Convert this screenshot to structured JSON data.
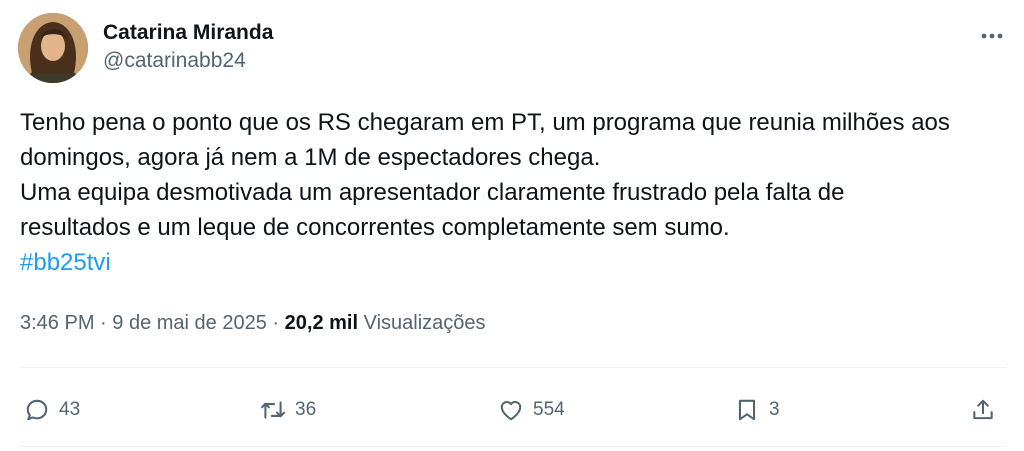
{
  "author": {
    "name": "Catarina Miranda",
    "handle": "@catarinabb24"
  },
  "tweet": {
    "lines": [
      "Tenho pena o ponto que os RS chegaram em PT, um programa que reunia milhões aos",
      "domingos, agora já nem a 1M de espectadores chega.",
      "Uma equipa desmotivada um apresentador claramente frustrado pela falta de",
      "resultados e um leque de concorrentes completamente sem sumo."
    ],
    "hashtag": "#bb25tvi"
  },
  "meta": {
    "time": "3:46 PM",
    "separator": "·",
    "date": "9 de mai de 2025",
    "views_count": "20,2 mil",
    "views_label": "Visualizações"
  },
  "actions": {
    "replies": "43",
    "reposts": "36",
    "likes": "554",
    "bookmarks": "3"
  },
  "icons": {
    "more": "more-horizontal-icon",
    "reply": "reply-icon",
    "repost": "repost-icon",
    "like": "heart-icon",
    "bookmark": "bookmark-icon",
    "share": "share-icon"
  },
  "colors": {
    "text": "#0f1419",
    "secondary": "#536471",
    "accent": "#1d9bf0",
    "divider": "#eff3f4"
  }
}
